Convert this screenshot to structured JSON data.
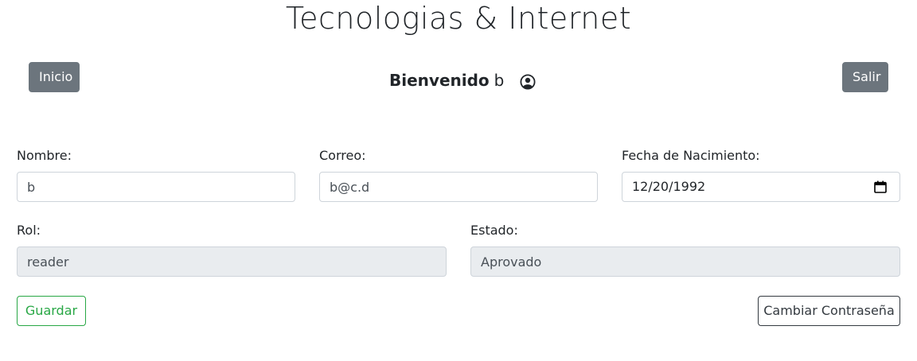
{
  "header": {
    "site_title": "Tecnologias & Internet",
    "home_button": "Inicio",
    "logout_button": "Salir",
    "welcome_label": "Bienvenido",
    "username": "b",
    "user_icon": "user-circle-icon"
  },
  "form": {
    "name": {
      "label": "Nombre:",
      "value": "b"
    },
    "email": {
      "label": "Correo:",
      "value": "b@c.d"
    },
    "birthdate": {
      "label": "Fecha de Nacimiento:",
      "value": "12/20/1992",
      "icon": "calendar-icon"
    },
    "role": {
      "label": "Rol:",
      "value": "reader"
    },
    "status": {
      "label": "Estado:",
      "value": "Aprovado"
    },
    "save_button": "Guardar",
    "change_password_button": "Cambiar Contraseña"
  },
  "colors": {
    "secondary": "#6c757d",
    "success": "#28a745",
    "dark": "#343a40",
    "readonly_bg": "#e9ecef"
  }
}
